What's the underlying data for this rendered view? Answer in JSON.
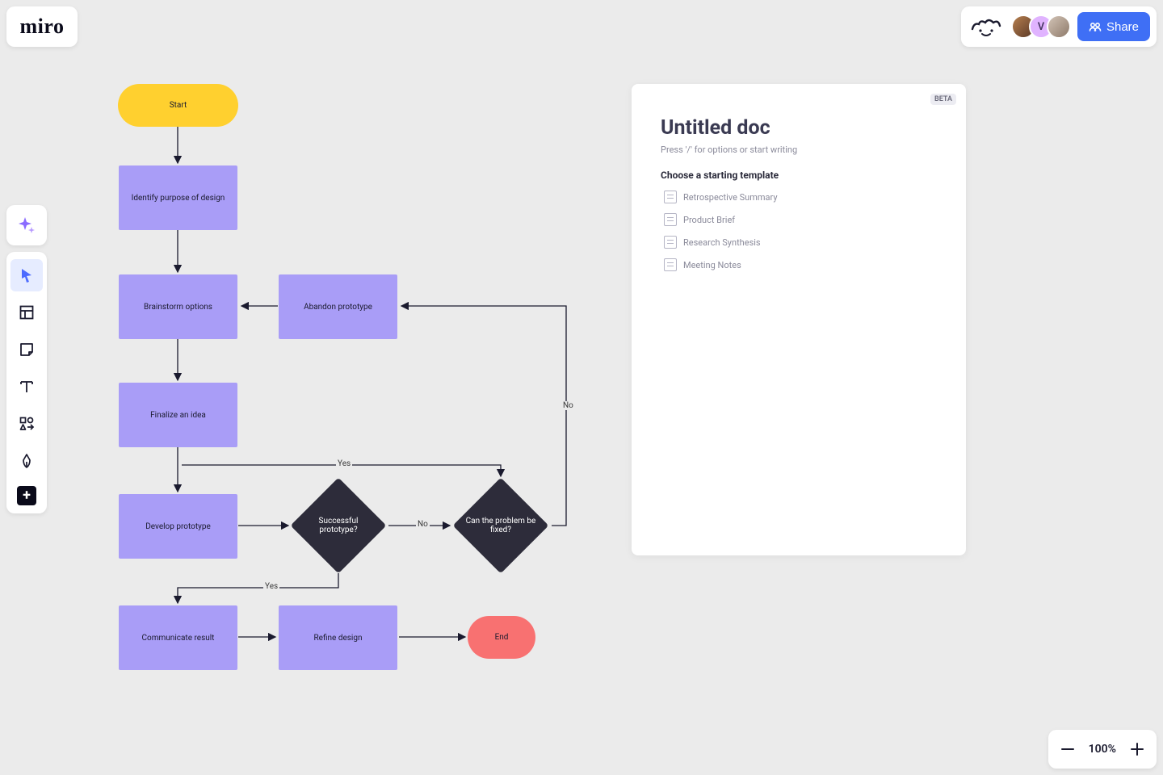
{
  "app": {
    "logo": "miro",
    "zoom": "100%",
    "share_label": "Share"
  },
  "collaborators": [
    {
      "initial": ""
    },
    {
      "initial": "V"
    },
    {
      "initial": ""
    }
  ],
  "flowchart": {
    "nodes": {
      "start": {
        "label": "Start"
      },
      "identify": {
        "label": "Identify purpose of design"
      },
      "brainstorm": {
        "label": "Brainstorm options"
      },
      "abandon": {
        "label": "Abandon prototype"
      },
      "finalize": {
        "label": "Finalize an idea"
      },
      "develop": {
        "label": "Develop prototype"
      },
      "successful": {
        "label": "Successful prototype?"
      },
      "fixable": {
        "label": "Can the problem be fixed?"
      },
      "communicate": {
        "label": "Communicate result"
      },
      "refine": {
        "label": "Refine design"
      },
      "end": {
        "label": "End"
      }
    },
    "edge_labels": {
      "successful_yes": "Yes",
      "successful_no": "No",
      "fixable_yes": "Yes",
      "fixable_no": "No"
    }
  },
  "doc_panel": {
    "beta_badge": "BETA",
    "title": "Untitled doc",
    "hint": "Press '/' for options or start writing",
    "templates_heading": "Choose a starting template",
    "templates": [
      {
        "label": "Retrospective Summary"
      },
      {
        "label": "Product Brief"
      },
      {
        "label": "Research Synthesis"
      },
      {
        "label": "Meeting Notes"
      }
    ]
  }
}
